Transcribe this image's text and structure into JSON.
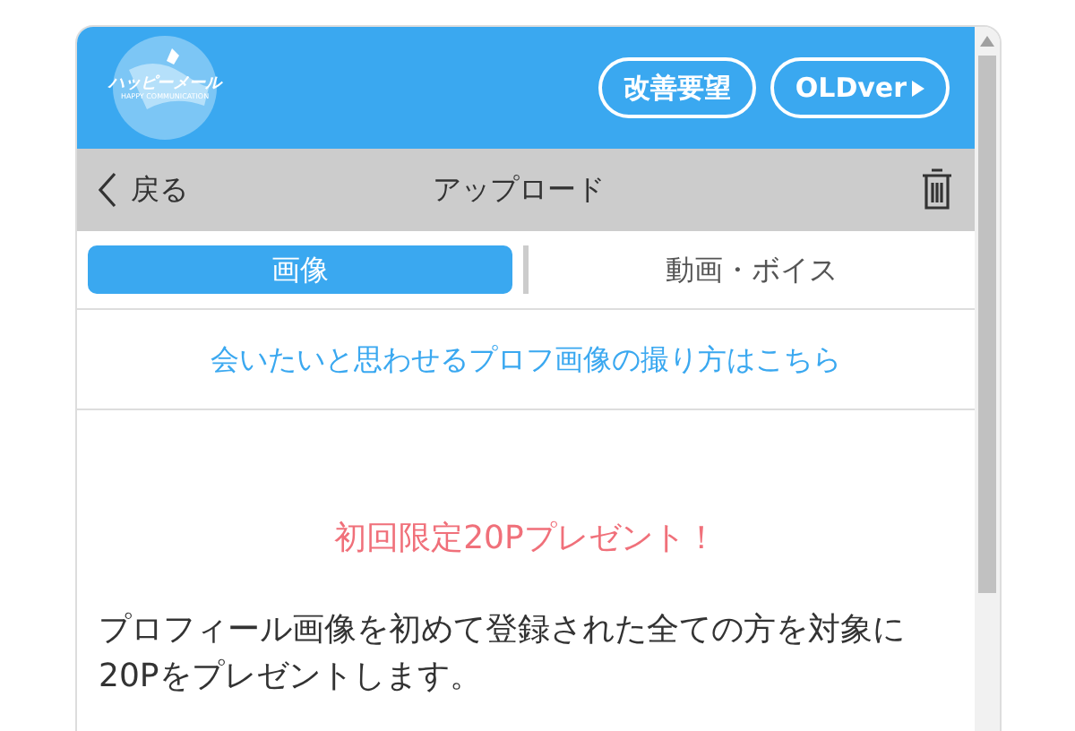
{
  "header": {
    "logo_title": "ハッピーメール",
    "logo_subtitle": "HAPPY COMMUNICATION",
    "buttons": [
      {
        "label": "改善要望",
        "kind": "plain"
      },
      {
        "label": "OLDver",
        "kind": "arrow"
      }
    ]
  },
  "toolbar": {
    "back": "戻る",
    "title": "アップロード"
  },
  "tabs": [
    {
      "label": "画像",
      "selected": true
    },
    {
      "label": "動画・ボイス",
      "selected": false
    }
  ],
  "guide_link": "会いたいと思わせるプロフ画像の撮り方はこちら",
  "promo": {
    "title": "初回限定20Pプレゼント！",
    "body": "プロフィール画像を初めて登録された全ての方を対象に20Pをプレゼントします。"
  }
}
